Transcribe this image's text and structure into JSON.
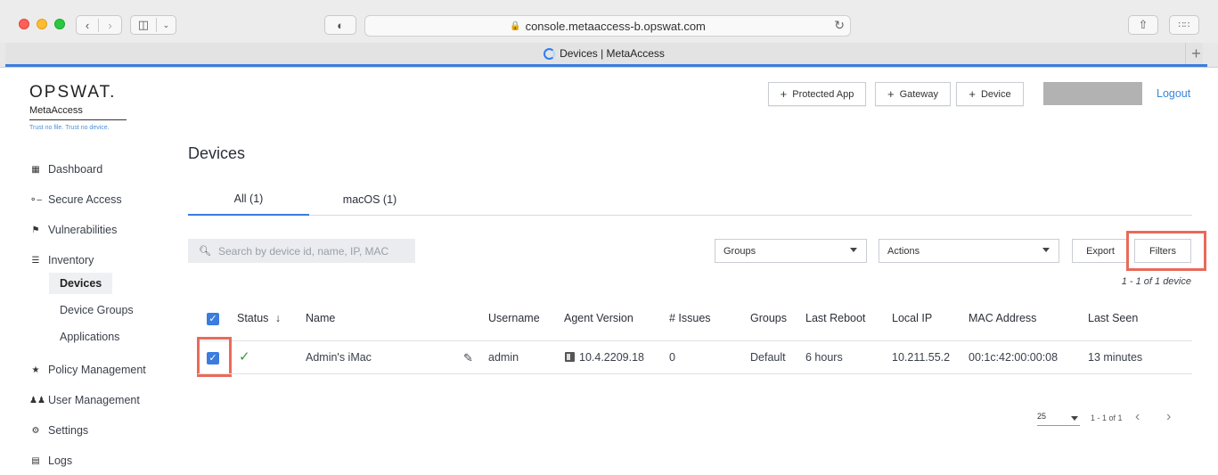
{
  "browser": {
    "url": "console.metaaccess-b.opswat.com",
    "tab_title": "Devices | MetaAccess"
  },
  "brand": {
    "logo": "OPSWAT.",
    "product": "MetaAccess",
    "tagline": "Trust no file. Trust no device."
  },
  "sidebar": {
    "items": [
      {
        "label": "Dashboard",
        "icon": "grid-icon"
      },
      {
        "label": "Secure Access",
        "icon": "key-icon"
      },
      {
        "label": "Vulnerabilities",
        "icon": "flag-icon"
      },
      {
        "label": "Inventory",
        "icon": "list-icon"
      },
      {
        "label": "Policy Management",
        "icon": "star-icon"
      },
      {
        "label": "User Management",
        "icon": "users-icon"
      },
      {
        "label": "Settings",
        "icon": "gear-icon"
      },
      {
        "label": "Logs",
        "icon": "clipboard-icon"
      }
    ],
    "inventory_sub": [
      "Devices",
      "Device Groups",
      "Applications"
    ]
  },
  "header": {
    "protected_app": "Protected App",
    "gateway": "Gateway",
    "device": "Device",
    "logout": "Logout"
  },
  "main": {
    "title": "Devices",
    "tabs": [
      "All (1)",
      "macOS (1)"
    ],
    "search_placeholder": "Search by device id, name, IP, MAC",
    "groups_select": "Groups",
    "actions_select": "Actions",
    "export": "Export",
    "filters": "Filters",
    "count": "1 - 1 of 1 device"
  },
  "table": {
    "columns": [
      "Status",
      "Name",
      "Username",
      "Agent Version",
      "# Issues",
      "Groups",
      "Last Reboot",
      "Local IP",
      "MAC Address",
      "Last Seen"
    ],
    "rows": [
      {
        "name": "Admin's iMac",
        "username": "admin",
        "agent_version": "10.4.2209.18",
        "issues": "0",
        "groups": "Default",
        "last_reboot": "6 hours",
        "local_ip": "10.211.55.2",
        "mac": "00:1c:42:00:00:08",
        "last_seen": "13 minutes"
      }
    ]
  },
  "pager": {
    "page_size": "25",
    "range": "1 - 1 of 1"
  },
  "colors": {
    "accent": "#3b7cde",
    "highlight": "#e96a5a",
    "link": "#3b87d6"
  }
}
